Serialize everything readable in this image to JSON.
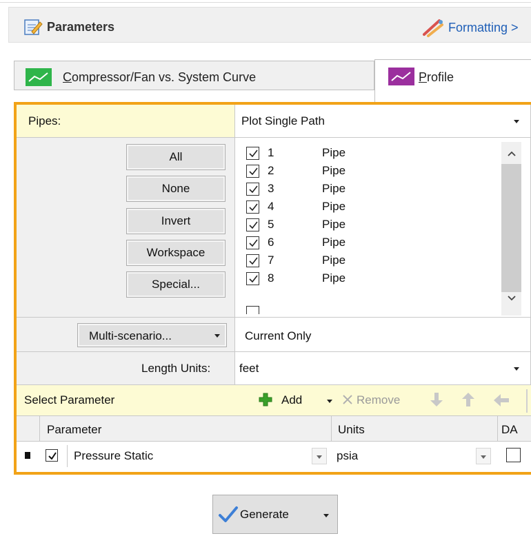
{
  "header": {
    "title": "Parameters",
    "formatting_label": "Formatting >"
  },
  "tabs": {
    "system_curve": {
      "label": "Compressor/Fan vs. System Curve",
      "underline_char": "C",
      "rest": "ompressor/Fan vs. System Curve"
    },
    "profile": {
      "label": "Profile",
      "underline_char": "P",
      "rest": "rofile"
    }
  },
  "pipes": {
    "label": "Pipes:",
    "mode_value": "Plot Single Path",
    "buttons": [
      "All",
      "None",
      "Invert",
      "Workspace",
      "Special..."
    ],
    "list": [
      {
        "num": "1",
        "type": "Pipe"
      },
      {
        "num": "2",
        "type": "Pipe"
      },
      {
        "num": "3",
        "type": "Pipe"
      },
      {
        "num": "4",
        "type": "Pipe"
      },
      {
        "num": "5",
        "type": "Pipe"
      },
      {
        "num": "6",
        "type": "Pipe"
      },
      {
        "num": "7",
        "type": "Pipe"
      },
      {
        "num": "8",
        "type": "Pipe"
      }
    ]
  },
  "scenario": {
    "button_label": "Multi-scenario...",
    "value": "Current Only"
  },
  "length_units": {
    "label": "Length Units:",
    "value": "feet"
  },
  "param_toolbar": {
    "title": "Select Parameter",
    "add": "Add",
    "remove": "Remove"
  },
  "param_table": {
    "headers": {
      "parameter": "Parameter",
      "units": "Units",
      "da": "DA"
    },
    "rows": [
      {
        "parameter": "Pressure Static",
        "units": "psia",
        "checked": true,
        "da": false
      }
    ]
  },
  "generate": {
    "label": "Generate"
  },
  "colors": {
    "panel_border": "#f2a318",
    "yellow_cell": "#fdfbd4",
    "link_blue": "#1f5fb7",
    "add_green": "#3aa02a"
  }
}
